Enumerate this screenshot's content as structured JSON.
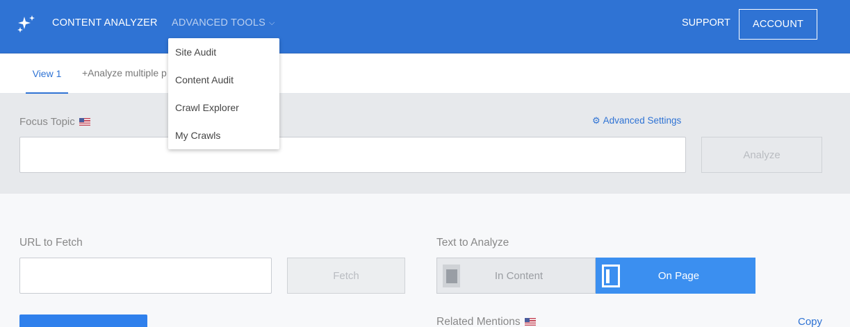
{
  "header": {
    "brand": "CONTENT ANALYZER",
    "advanced_tools": "ADVANCED TOOLS",
    "support": "SUPPORT",
    "account": "ACCOUNT",
    "color": "#2f73d4"
  },
  "dropdown": {
    "items": [
      "Site Audit",
      "Content Audit",
      "Crawl Explorer",
      "My Crawls"
    ]
  },
  "tabs": {
    "view1": "View 1",
    "analyze_multiple": "+Analyze multiple p"
  },
  "focus": {
    "label": "Focus Topic",
    "advanced_settings": "Advanced Settings",
    "input_value": "",
    "analyze_button": "Analyze"
  },
  "fetch": {
    "label": "URL to Fetch",
    "input_value": "",
    "button": "Fetch"
  },
  "text_to_analyze": {
    "label": "Text to Analyze",
    "options": [
      "In Content",
      "On Page"
    ],
    "selected": "On Page"
  },
  "related": {
    "label": "Related Mentions",
    "copy": "Copy"
  },
  "icons": [
    "sparkles-icon",
    "chevron-down-icon",
    "flag-us-icon",
    "gear-icon",
    "in-content-icon",
    "on-page-icon"
  ]
}
